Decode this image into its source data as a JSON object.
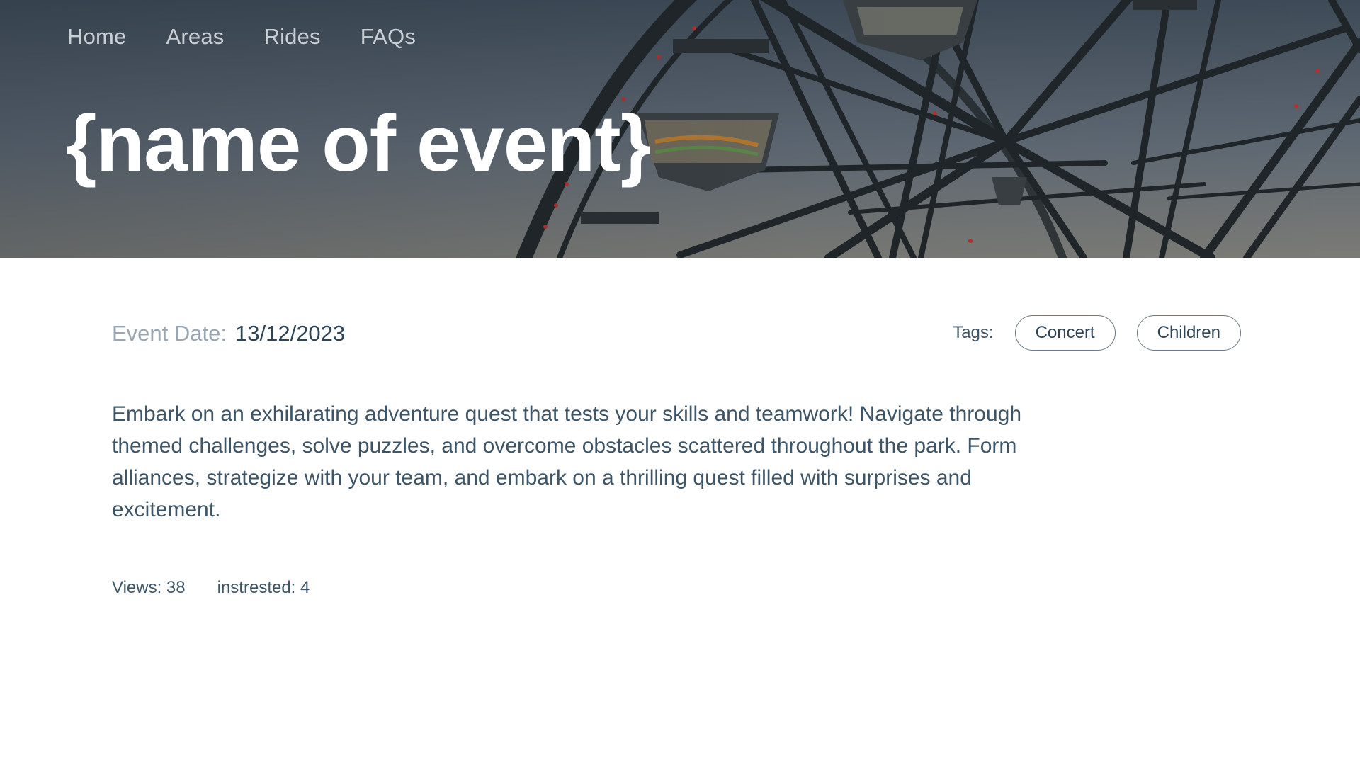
{
  "nav": {
    "items": [
      {
        "label": "Home"
      },
      {
        "label": "Areas"
      },
      {
        "label": "Rides"
      },
      {
        "label": "FAQs"
      }
    ]
  },
  "hero": {
    "title": "{name of event}"
  },
  "event": {
    "date_label": "Event Date:",
    "date_value": "13/12/2023",
    "tags_label": "Tags:",
    "tags": [
      {
        "label": "Concert"
      },
      {
        "label": "Children"
      }
    ],
    "description": "Embark on an exhilarating adventure quest that tests your skills and teamwork! Navigate through themed challenges, solve puzzles, and overcome obstacles scattered throughout the park. Form alliances, strategize with your team, and embark on a thrilling quest filled with surprises and excitement.",
    "views_text": "Views: 38",
    "interested_text": "instrested: 4"
  },
  "colors": {
    "hero_bg": "#4a5764",
    "text_primary": "#2f4454",
    "text_muted": "#9aa7b3",
    "nav_text": "#c9cfd5"
  }
}
